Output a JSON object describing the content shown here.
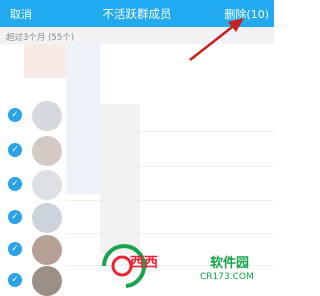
{
  "header": {
    "cancel_label": "取消",
    "title": "不活跃群成员",
    "delete_label": "删除(10)"
  },
  "section": {
    "label": "超过3个月 (55个)"
  },
  "members": [
    {
      "checked": true,
      "avatar_color": "#cfd3da"
    },
    {
      "checked": true,
      "avatar_color": "#cfc6c2"
    },
    {
      "checked": true,
      "avatar_color": "#d9dce0"
    },
    {
      "checked": true,
      "avatar_color": "#c9cfd8"
    },
    {
      "checked": true,
      "avatar_color": "#b9a8a0"
    },
    {
      "checked": true,
      "avatar_color": "#a3998f"
    }
  ],
  "watermark": {
    "brand": "西西",
    "site": "软件园",
    "url": "CR173.COM"
  },
  "colors": {
    "accent": "#22aaee",
    "check": "#2aa2e8",
    "arrow": "#c81e1e"
  }
}
